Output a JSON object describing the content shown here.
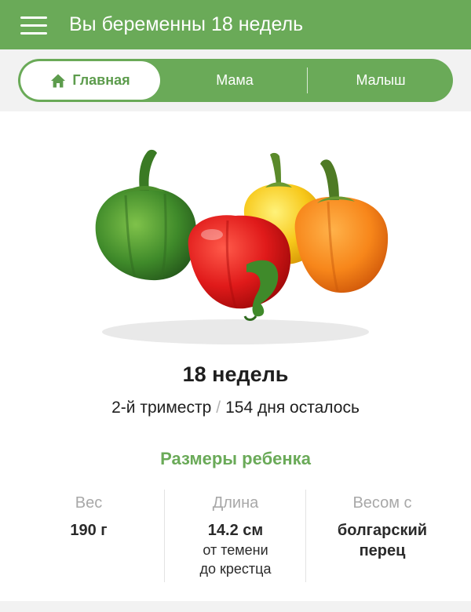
{
  "header": {
    "title": "Вы беременны 18 недель",
    "menu_icon": "hamburger-menu-icon"
  },
  "tabs": [
    {
      "label": "Главная",
      "icon": "home-icon",
      "selected": true
    },
    {
      "label": "Мама",
      "selected": false
    },
    {
      "label": "Малыш",
      "selected": false
    }
  ],
  "hero": {
    "image": "bell-peppers-photo",
    "image_contents": [
      "green pepper",
      "yellow pepper",
      "red pepper",
      "orange pepper"
    ]
  },
  "week": {
    "title": "18 недель",
    "trimester": "2-й триместр",
    "separator": "/",
    "remaining": "154 дня осталось"
  },
  "baby_sizes": {
    "title": "Размеры ребенка",
    "stats": [
      {
        "label": "Вес",
        "value": "190 г"
      },
      {
        "label": "Длина",
        "value": "14.2 см",
        "note_line1": "от темени",
        "note_line2": "до крестца"
      },
      {
        "label": "Весом с",
        "value_line1": "болгарский",
        "value_line2": "перец"
      }
    ]
  },
  "colors": {
    "brand_green": "#6aaa58",
    "tab_active_text": "#5d9c4d",
    "muted_label": "#a8a8a8"
  }
}
